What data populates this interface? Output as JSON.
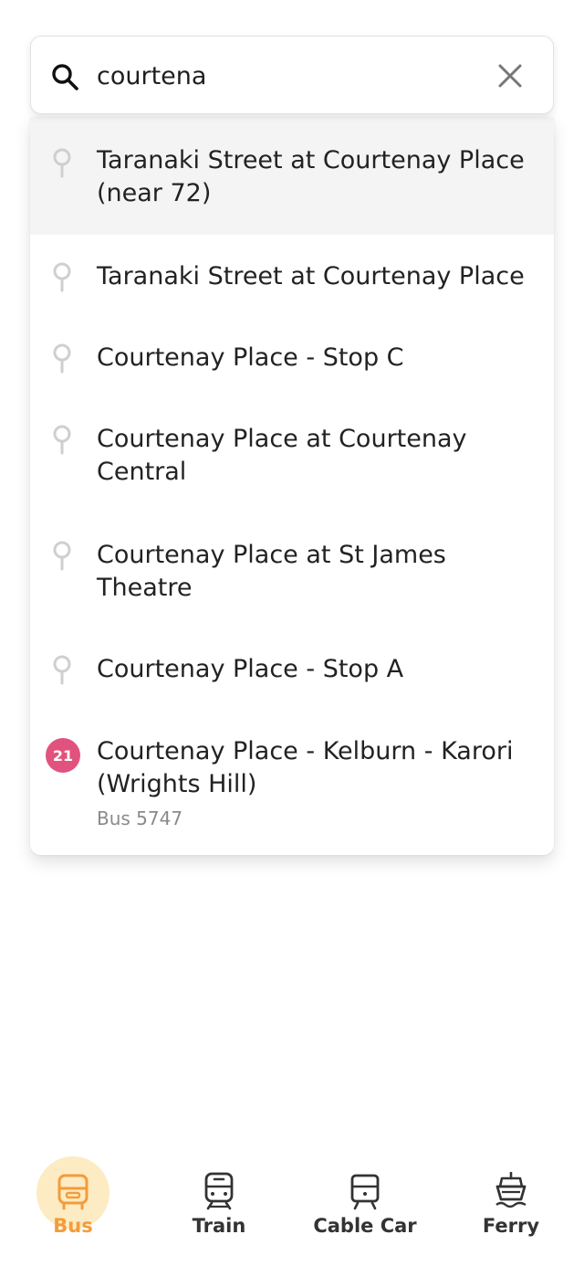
{
  "search": {
    "value": "courtena",
    "search_icon": "search-icon",
    "clear_icon": "close-icon"
  },
  "results": [
    {
      "title": "Taranaki Street at Courtenay Place (near 72)",
      "icon": "location-pin-icon"
    },
    {
      "title": "Taranaki Street at Courtenay Place",
      "icon": "location-pin-icon"
    },
    {
      "title": "Courtenay Place - Stop C",
      "icon": "location-pin-icon"
    },
    {
      "title": "Courtenay Place at Courtenay Central",
      "icon": "location-pin-icon"
    },
    {
      "title": "Courtenay Place at St James Theatre",
      "icon": "location-pin-icon"
    },
    {
      "title": "Courtenay Place - Stop A",
      "icon": "location-pin-icon"
    },
    {
      "title": "Courtenay Place - Kelburn - Karori (Wrights Hill)",
      "badge": "21",
      "subtitle": "Bus 5747"
    }
  ],
  "tabs": [
    {
      "label": "Bus",
      "icon": "bus-icon",
      "active": true
    },
    {
      "label": "Train",
      "icon": "train-icon",
      "active": false
    },
    {
      "label": "Cable Car",
      "icon": "cable-car-icon",
      "active": false
    },
    {
      "label": "Ferry",
      "icon": "ferry-icon",
      "active": false
    }
  ],
  "colors": {
    "accent": "#f39c3a",
    "accent_bg": "#fdebc3",
    "route_badge": "#e2527e",
    "highlight_row": "#f4f4f4",
    "muted_text": "#8a8a8a"
  }
}
